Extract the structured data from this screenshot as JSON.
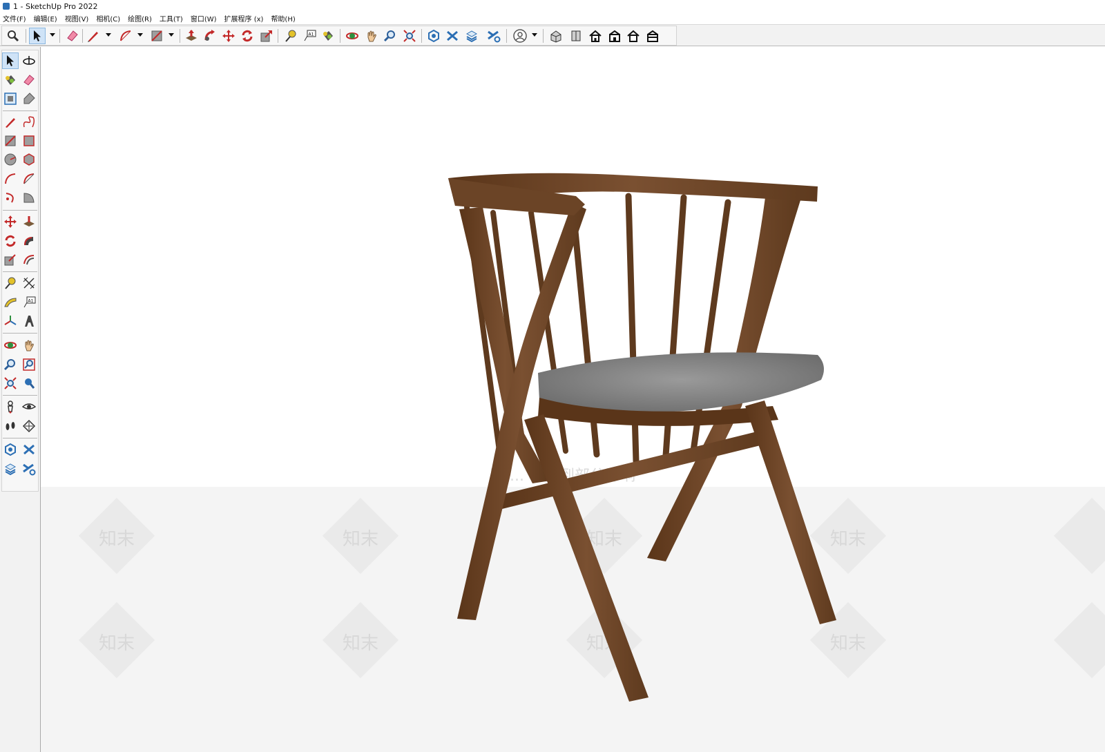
{
  "window": {
    "title": "1 - SketchUp Pro 2022",
    "accent": "#2c6fb4"
  },
  "menu": [
    {
      "label": "文件(F)"
    },
    {
      "label": "编辑(E)"
    },
    {
      "label": "视图(V)"
    },
    {
      "label": "相机(C)"
    },
    {
      "label": "绘图(R)"
    },
    {
      "label": "工具(T)"
    },
    {
      "label": "窗口(W)"
    },
    {
      "label": "扩展程序 (x)"
    },
    {
      "label": "帮助(H)"
    }
  ],
  "toolbar": {
    "active_tool": "select-tool",
    "tools": [
      "search-icon",
      "select-icon",
      "eraser-icon",
      "pencil-icon",
      "arc-icon",
      "rectangle-icon",
      "push-pull-icon",
      "follow-me-icon",
      "move-icon",
      "rotate-icon",
      "scale-icon",
      "tape-measure-icon",
      "text-label-icon",
      "paint-bucket-icon",
      "orbit-icon",
      "pan-icon",
      "zoom-icon",
      "zoom-extents-icon",
      "warehouse-icon",
      "extension-warehouse-icon",
      "layout-icon",
      "extension-manager-icon",
      "account-icon",
      "iso-view-icon",
      "top-view-icon",
      "front-view-icon",
      "right-view-icon",
      "back-view-icon",
      "left-view-icon"
    ]
  },
  "left_toolbar": {
    "active_tool": "select-tool",
    "tools": [
      "select-icon",
      "orbit-icon",
      "paint-bucket-icon",
      "eraser-icon",
      "component-icon",
      "tag-icon",
      "pencil-icon",
      "freehand-icon",
      "rectangle-icon",
      "rotated-rectangle-icon",
      "circle-icon",
      "polygon-icon",
      "arc-icon",
      "two-point-arc-icon",
      "three-point-arc-icon",
      "pie-icon",
      "move-icon",
      "push-pull-icon",
      "rotate-icon",
      "follow-me-icon",
      "scale-icon",
      "offset-icon",
      "tape-measure-icon",
      "dimension-icon",
      "protractor-icon",
      "text-icon",
      "axes-icon",
      "3d-text-icon",
      "orbit-icon",
      "pan-icon",
      "zoom-icon",
      "zoom-window-icon",
      "zoom-extents-icon",
      "previous-view-icon",
      "position-camera-icon",
      "look-around-icon",
      "walk-icon",
      "section-plane-icon",
      "warehouse-icon",
      "extension-warehouse-icon",
      "layout-icon",
      "extension-manager-icon"
    ]
  },
  "viewport": {
    "background": "#ffffff",
    "ground": "#f4f4f4",
    "model": "wooden armchair with grey seat",
    "wood_color": "#6b4426",
    "seat_color": "#8a8a8a",
    "watermark": "知末",
    "watermark_note": "区 ... 会受到部分影响"
  }
}
